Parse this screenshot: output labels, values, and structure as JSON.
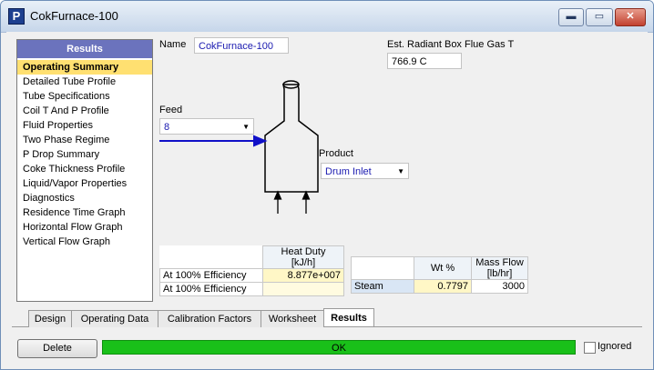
{
  "window": {
    "app_icon_letter": "P",
    "title": "CokFurnace-100",
    "buttons": {
      "minimize": "▬",
      "maximize": "▭",
      "close": "✕"
    }
  },
  "results": {
    "header": "Results",
    "items": [
      {
        "label": "Operating Summary",
        "selected": true
      },
      {
        "label": "Detailed Tube Profile"
      },
      {
        "label": "Tube Specifications"
      },
      {
        "label": "Coil T And P Profile"
      },
      {
        "label": "Fluid Properties"
      },
      {
        "label": "Two Phase Regime"
      },
      {
        "label": "P Drop Summary"
      },
      {
        "label": "Coke Thickness Profile"
      },
      {
        "label": "Liquid/Vapor Properties"
      },
      {
        "label": "Diagnostics"
      },
      {
        "label": "Residence Time Graph"
      },
      {
        "label": "Horizontal Flow Graph"
      },
      {
        "label": "Vertical Flow Graph"
      }
    ]
  },
  "form": {
    "name_label": "Name",
    "name_value": "CokFurnace-100",
    "flue_gas_label": "Est. Radiant Box Flue Gas T",
    "flue_gas_value": "766.9 C",
    "feed_label": "Feed",
    "feed_value": "8",
    "product_label": "Product",
    "product_value": "Drum Inlet"
  },
  "heat_duty_table": {
    "header_line1": "Heat Duty",
    "header_line2": "[kJ/h]",
    "rows": [
      {
        "label": "At 100% Efficiency",
        "value": "8.877e+007"
      },
      {
        "label": "At 100% Efficiency",
        "value": ""
      }
    ]
  },
  "mass_flow_table": {
    "col1_header": "Wt %",
    "col2_header_line1": "Mass Flow",
    "col2_header_line2": "[lb/hr]",
    "rows": [
      {
        "label": "Steam",
        "wt": "0.7797",
        "flow": "3000"
      }
    ]
  },
  "tabs": [
    {
      "label": "Design"
    },
    {
      "label": "Operating Data"
    },
    {
      "label": "Calibration Factors"
    },
    {
      "label": "Worksheet"
    },
    {
      "label": "Results",
      "active": true
    }
  ],
  "footer": {
    "delete_label": "Delete",
    "status_text": "OK",
    "status_color": "#19c019",
    "ignored_label": "Ignored",
    "ignored_checked": false
  }
}
